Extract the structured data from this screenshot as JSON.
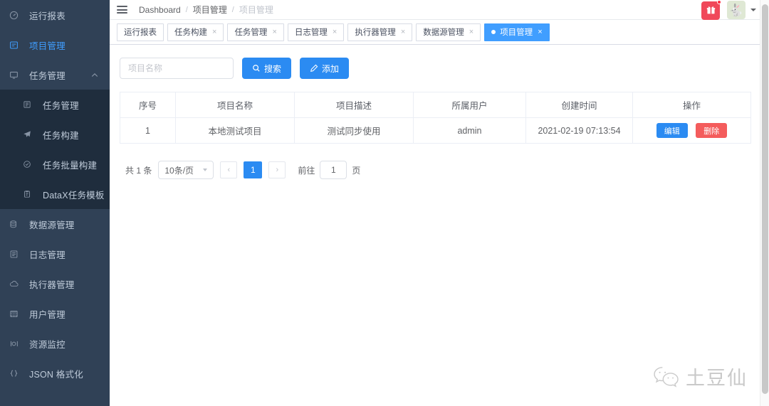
{
  "sidebar": {
    "items": [
      {
        "label": "运行报表",
        "icon": "dashboard-icon",
        "active": false,
        "expandable": false
      },
      {
        "label": "项目管理",
        "icon": "project-icon",
        "active": true,
        "expandable": false
      },
      {
        "label": "任务管理",
        "icon": "monitor-icon",
        "active": false,
        "expandable": true
      }
    ],
    "submenu": [
      {
        "label": "任务管理",
        "icon": "task-icon"
      },
      {
        "label": "任务构建",
        "icon": "send-icon"
      },
      {
        "label": "任务批量构建",
        "icon": "check-circle-icon"
      },
      {
        "label": "DataX任务模板",
        "icon": "clipboard-icon"
      }
    ],
    "items_bottom": [
      {
        "label": "数据源管理",
        "icon": "database-icon"
      },
      {
        "label": "日志管理",
        "icon": "log-icon"
      },
      {
        "label": "执行器管理",
        "icon": "cloud-icon"
      },
      {
        "label": "用户管理",
        "icon": "grid-icon"
      },
      {
        "label": "资源监控",
        "icon": "monitor-resource-icon"
      },
      {
        "label": "JSON 格式化",
        "icon": "braces-icon"
      }
    ]
  },
  "navbar": {
    "hamburger": "collapse-menu-icon",
    "breadcrumb": [
      {
        "label": "Dashboard",
        "muted": false
      },
      {
        "label": "项目管理",
        "muted": false
      },
      {
        "label": "项目管理",
        "muted": true
      }
    ],
    "separator": "/",
    "gift_icon": "gift-icon",
    "avatar_icon": "rabbit-avatar"
  },
  "tabs": [
    {
      "label": "运行报表",
      "active": false,
      "closable": false
    },
    {
      "label": "任务构建",
      "active": false,
      "closable": true
    },
    {
      "label": "任务管理",
      "active": false,
      "closable": true
    },
    {
      "label": "日志管理",
      "active": false,
      "closable": true
    },
    {
      "label": "执行器管理",
      "active": false,
      "closable": true
    },
    {
      "label": "数据源管理",
      "active": false,
      "closable": true
    },
    {
      "label": "项目管理",
      "active": true,
      "closable": true
    }
  ],
  "tab_close_glyph": "×",
  "filter": {
    "placeholder": "项目名称",
    "value": "",
    "search_label": "搜索",
    "search_icon": "search-icon",
    "add_label": "添加",
    "add_icon": "edit-pen-icon"
  },
  "table": {
    "columns": [
      "序号",
      "项目名称",
      "项目描述",
      "所属用户",
      "创建时间",
      "操作"
    ],
    "rows": [
      {
        "index": "1",
        "name": "本地测试项目",
        "description": "测试同步使用",
        "user": "admin",
        "created": "2021-02-19 07:13:54",
        "edit_label": "编辑",
        "delete_label": "删除"
      }
    ]
  },
  "pagination": {
    "total_text": "共 1 条",
    "page_size": "10条/页",
    "prev_glyph": "‹",
    "next_glyph": "›",
    "current_page": "1",
    "jump_prefix": "前往",
    "jump_value": "1",
    "jump_suffix": "页"
  },
  "watermark": {
    "icon": "wechat-icon",
    "text": "土豆仙"
  },
  "colors": {
    "sidebar_bg": "#304156",
    "submenu_bg": "#1f2d3d",
    "accent": "#409EFF",
    "button_blue": "#2b8bf2",
    "danger": "#f45c5c",
    "gift_red": "#f0485a"
  }
}
